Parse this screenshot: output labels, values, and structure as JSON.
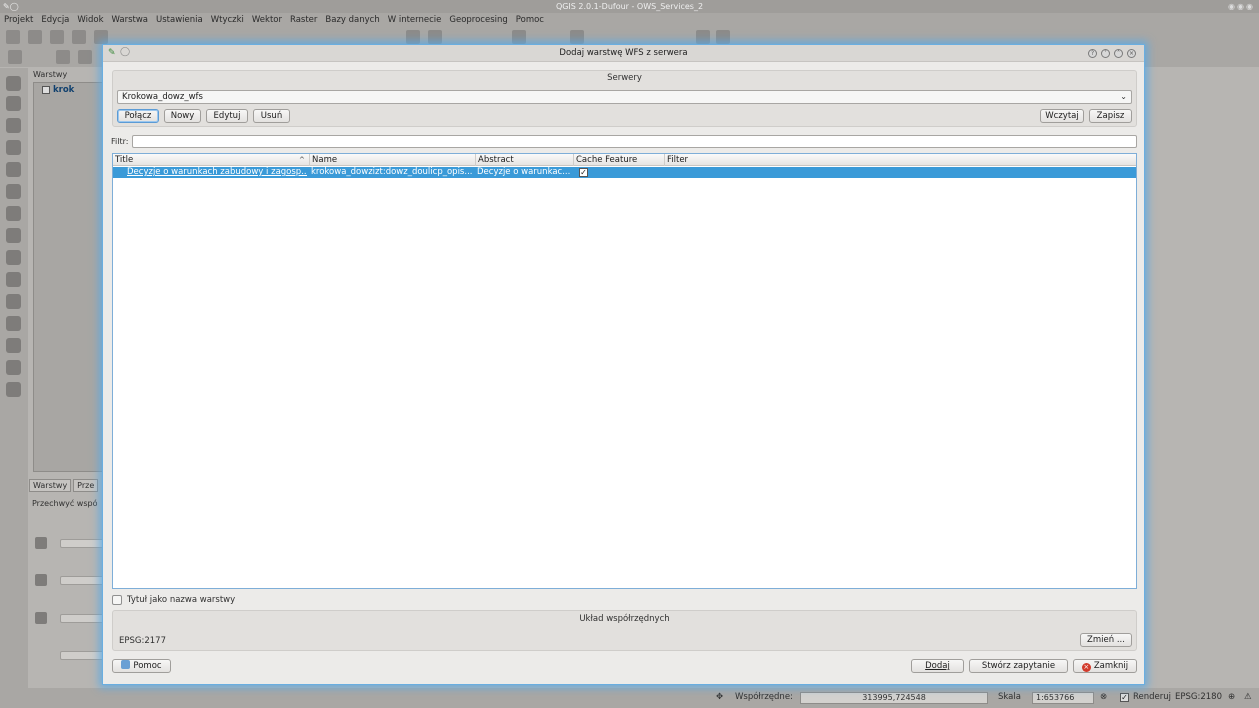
{
  "app": {
    "title": "QGIS 2.0.1-Dufour - OWS_Services_2",
    "menu": [
      "Projekt",
      "Edycja",
      "Widok",
      "Warstwa",
      "Ustawienia",
      "Wtyczki",
      "Wektor",
      "Raster",
      "Bazy danych",
      "W internecie",
      "Geoprocesing",
      "Pomoc"
    ]
  },
  "layers_panel": {
    "title": "Warstwy",
    "layer_name": "krok",
    "tabs": [
      "Warstwy",
      "Prze"
    ],
    "przechwyc_label": "Przechwyć wspó"
  },
  "statusbar": {
    "coords_label": "Współrzędne:",
    "coords_value": "313995,724548",
    "scale_label": "Skala",
    "scale_value": "1:653766",
    "render_label": "Renderuj",
    "epsg": "EPSG:2180"
  },
  "dialog": {
    "title": "Dodaj warstwę WFS z serwera",
    "servers": {
      "label": "Serwery",
      "selected": "Krokowa_dowz_wfs",
      "buttons": {
        "connect": "Połącz",
        "new": "Nowy",
        "edit": "Edytuj",
        "delete": "Usuń",
        "load": "Wczytaj",
        "save": "Zapisz"
      }
    },
    "filter_label": "Filtr:",
    "table": {
      "columns": [
        "Title",
        "Name",
        "Abstract",
        "Cache Feature",
        "Filter"
      ],
      "rows": [
        {
          "title": "Decyzje o warunkach zabudowy i zagosp...",
          "name": "krokowa_dowzizt:dowz_doulicp_opis...",
          "abstract": "Decyzje o warunkac...",
          "cache_feature": "✓",
          "filter": ""
        }
      ]
    },
    "title_as_layer_name": "Tytuł jako nazwa warstwy",
    "crs": {
      "label": "Układ współrzędnych",
      "value": "EPSG:2177",
      "change_button": "Zmień ..."
    },
    "buttons": {
      "help": "Pomoc",
      "add": "Dodaj",
      "build_query": "Stwórz zapytanie",
      "close": "Zamknij"
    }
  },
  "colors": {
    "selection": "#3a9ad8",
    "dialog_glow": "#6aaee0",
    "close_red": "#d23a2a"
  }
}
